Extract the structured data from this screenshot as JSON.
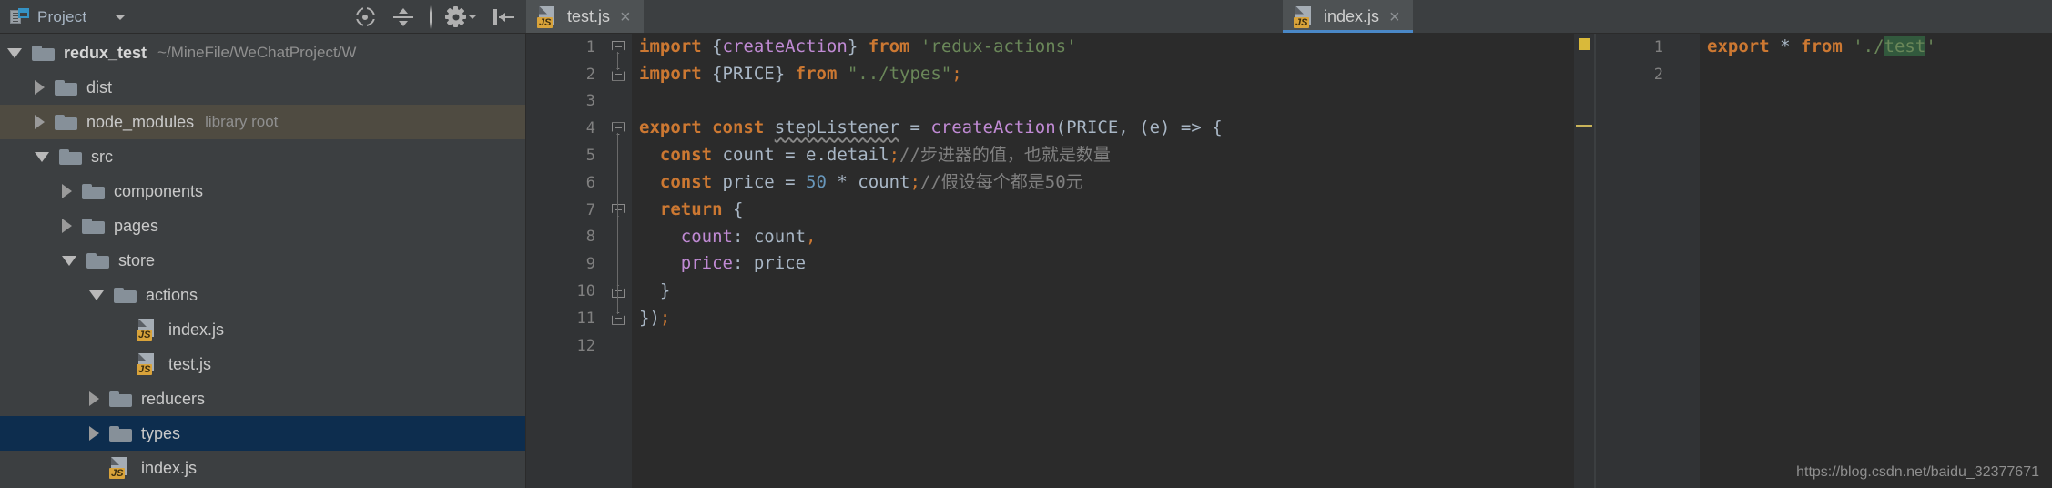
{
  "project_panel": {
    "title": "Project",
    "icons": {
      "project": "project-view-icon",
      "dropdown": "chevron-down-icon",
      "locate": "scroll-from-source-icon",
      "collapse": "collapse-all-icon",
      "settings": "gear-icon",
      "settings_caret": "chevron-down-icon",
      "hide": "hide-panel-icon"
    },
    "tree": [
      {
        "label": "redux_test",
        "sub": "~/MineFile/WeChatProject/W",
        "type": "folder",
        "state": "expanded",
        "depth": 0,
        "root": true,
        "selected": false,
        "excluded": false
      },
      {
        "label": "dist",
        "sub": "",
        "type": "folder",
        "state": "collapsed",
        "depth": 1,
        "root": false,
        "selected": false,
        "excluded": false
      },
      {
        "label": "node_modules",
        "sub": "library root",
        "type": "folder",
        "state": "collapsed",
        "depth": 1,
        "root": false,
        "selected": false,
        "excluded": true
      },
      {
        "label": "src",
        "sub": "",
        "type": "folder",
        "state": "expanded",
        "depth": 1,
        "root": false,
        "selected": false,
        "excluded": false
      },
      {
        "label": "components",
        "sub": "",
        "type": "folder",
        "state": "collapsed",
        "depth": 2,
        "root": false,
        "selected": false,
        "excluded": false
      },
      {
        "label": "pages",
        "sub": "",
        "type": "folder",
        "state": "collapsed",
        "depth": 2,
        "root": false,
        "selected": false,
        "excluded": false
      },
      {
        "label": "store",
        "sub": "",
        "type": "folder",
        "state": "expanded",
        "depth": 2,
        "root": false,
        "selected": false,
        "excluded": false
      },
      {
        "label": "actions",
        "sub": "",
        "type": "folder",
        "state": "expanded",
        "depth": 3,
        "root": false,
        "selected": false,
        "excluded": false
      },
      {
        "label": "index.js",
        "sub": "",
        "type": "js",
        "state": "leaf",
        "depth": 4,
        "root": false,
        "selected": false,
        "excluded": false
      },
      {
        "label": "test.js",
        "sub": "",
        "type": "js",
        "state": "leaf",
        "depth": 4,
        "root": false,
        "selected": false,
        "excluded": false
      },
      {
        "label": "reducers",
        "sub": "",
        "type": "folder",
        "state": "collapsed",
        "depth": 3,
        "root": false,
        "selected": false,
        "excluded": false
      },
      {
        "label": "types",
        "sub": "",
        "type": "folder",
        "state": "collapsed",
        "depth": 3,
        "root": false,
        "selected": true,
        "excluded": false
      },
      {
        "label": "index.js",
        "sub": "",
        "type": "js",
        "state": "leaf",
        "depth": 3,
        "root": false,
        "selected": false,
        "excluded": false
      }
    ],
    "file_badge": "JS"
  },
  "editors": {
    "left": {
      "tab": {
        "label": "test.js",
        "badge": "JS",
        "close": "×",
        "active": false
      },
      "line_numbers": [
        "1",
        "2",
        "3",
        "4",
        "5",
        "6",
        "7",
        "8",
        "9",
        "10",
        "11",
        "12"
      ],
      "lines": [
        {
          "n": "1",
          "tokens": [
            {
              "t": "import",
              "c": "kw"
            },
            {
              "t": " ",
              "c": "plain"
            },
            {
              "t": "{",
              "c": "punct"
            },
            {
              "t": "createAction",
              "c": "fn"
            },
            {
              "t": "}",
              "c": "punct"
            },
            {
              "t": " ",
              "c": "plain"
            },
            {
              "t": "from",
              "c": "kw"
            },
            {
              "t": " ",
              "c": "plain"
            },
            {
              "t": "'redux-actions'",
              "c": "str"
            }
          ]
        },
        {
          "n": "2",
          "tokens": [
            {
              "t": "import",
              "c": "kw"
            },
            {
              "t": " ",
              "c": "plain"
            },
            {
              "t": "{PRICE}",
              "c": "punct"
            },
            {
              "t": " ",
              "c": "plain"
            },
            {
              "t": "from",
              "c": "kw"
            },
            {
              "t": " ",
              "c": "plain"
            },
            {
              "t": "\"../types\"",
              "c": "str"
            },
            {
              "t": ";",
              "c": "semi"
            }
          ]
        },
        {
          "n": "3",
          "tokens": []
        },
        {
          "n": "4",
          "tokens": [
            {
              "t": "export",
              "c": "kw"
            },
            {
              "t": " ",
              "c": "plain"
            },
            {
              "t": "const",
              "c": "kw"
            },
            {
              "t": " ",
              "c": "plain"
            },
            {
              "t": "stepListener",
              "c": "plain squiggle"
            },
            {
              "t": " = ",
              "c": "plain"
            },
            {
              "t": "createAction",
              "c": "fn"
            },
            {
              "t": "(PRICE, (e) => {",
              "c": "punct"
            }
          ]
        },
        {
          "n": "5",
          "tokens": [
            {
              "t": "  ",
              "c": "plain"
            },
            {
              "t": "const",
              "c": "kw"
            },
            {
              "t": " count = e.detail",
              "c": "plain"
            },
            {
              "t": ";",
              "c": "semi"
            },
            {
              "t": "//步进器的值，也就是数量",
              "c": "cmt"
            }
          ]
        },
        {
          "n": "6",
          "tokens": [
            {
              "t": "  ",
              "c": "plain"
            },
            {
              "t": "const",
              "c": "kw"
            },
            {
              "t": " price = ",
              "c": "plain"
            },
            {
              "t": "50",
              "c": "num"
            },
            {
              "t": " * count",
              "c": "plain"
            },
            {
              "t": ";",
              "c": "semi"
            },
            {
              "t": "//假设每个都是50元",
              "c": "cmt"
            }
          ]
        },
        {
          "n": "7",
          "tokens": [
            {
              "t": "  ",
              "c": "plain"
            },
            {
              "t": "return",
              "c": "kw"
            },
            {
              "t": " {",
              "c": "punct"
            }
          ]
        },
        {
          "n": "8",
          "tokens": [
            {
              "t": "    ",
              "c": "plain"
            },
            {
              "t": "count",
              "c": "prop"
            },
            {
              "t": ": count",
              "c": "plain"
            },
            {
              "t": ",",
              "c": "semi"
            }
          ]
        },
        {
          "n": "9",
          "tokens": [
            {
              "t": "    ",
              "c": "plain"
            },
            {
              "t": "price",
              "c": "prop"
            },
            {
              "t": ": price",
              "c": "plain"
            }
          ]
        },
        {
          "n": "10",
          "tokens": [
            {
              "t": "  }",
              "c": "punct"
            }
          ]
        },
        {
          "n": "11",
          "tokens": [
            {
              "t": "})",
              "c": "punct"
            },
            {
              "t": ";",
              "c": "semi"
            }
          ]
        },
        {
          "n": "12",
          "tokens": []
        }
      ]
    },
    "right": {
      "tab": {
        "label": "index.js",
        "badge": "JS",
        "close": "×",
        "active": true
      },
      "line_numbers": [
        "1",
        "2"
      ],
      "lines": [
        {
          "n": "1",
          "tokens": [
            {
              "t": "export",
              "c": "kw"
            },
            {
              "t": " ",
              "c": "plain"
            },
            {
              "t": "*",
              "c": "plain"
            },
            {
              "t": " ",
              "c": "plain"
            },
            {
              "t": "from",
              "c": "kw"
            },
            {
              "t": " ",
              "c": "plain"
            },
            {
              "t": "'./",
              "c": "str"
            },
            {
              "t": "test",
              "c": "str hl-usage"
            },
            {
              "t": "'",
              "c": "str"
            }
          ]
        },
        {
          "n": "2",
          "tokens": []
        }
      ]
    }
  },
  "watermark": "https://blog.csdn.net/baidu_32377671",
  "colors": {
    "panel_bg": "#3c3f41",
    "editor_bg": "#2b2b2b",
    "gutter_bg": "#313335",
    "selection": "#0d2d4e",
    "excluded": "#4f4b41",
    "keyword": "#cc7832",
    "string": "#6a8759",
    "number": "#6897bb",
    "comment": "#808080",
    "function": "#c08ad4",
    "text": "#a9b7c6",
    "tab_active_underline": "#4a88c7",
    "js_badge": "#d9a33a",
    "usage_highlight": "#32593d",
    "warning_stripe": "#d9b93a"
  }
}
